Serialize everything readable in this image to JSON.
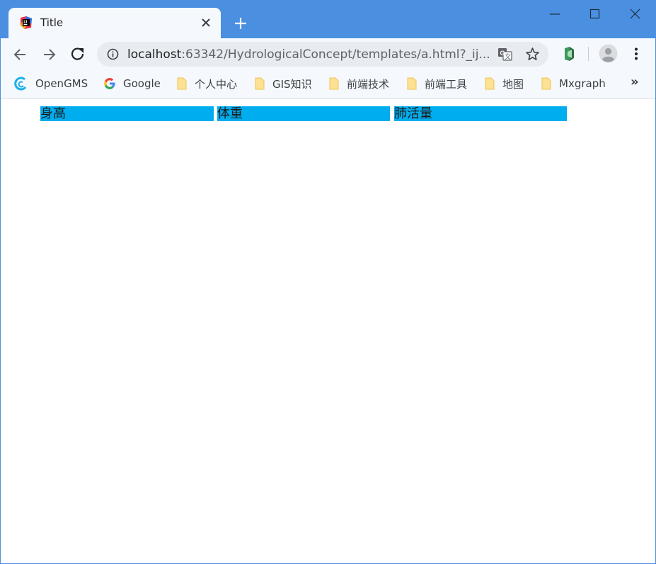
{
  "browser": {
    "tab": {
      "title": "Title",
      "favicon": "intellij-logo-icon"
    },
    "address_bar": {
      "host": "localhost",
      "rest": ":63342/HydrologicalConcept/templates/a.html?_ij..."
    },
    "bookmarks": [
      {
        "label": "OpenGMS",
        "icon": "opengms-logo-icon"
      },
      {
        "label": "Google",
        "icon": "google-logo-icon"
      },
      {
        "label": "个人中心",
        "icon": "folder-icon"
      },
      {
        "label": "GIS知识",
        "icon": "folder-icon"
      },
      {
        "label": "前端技术",
        "icon": "folder-icon"
      },
      {
        "label": "前端工具",
        "icon": "folder-icon"
      },
      {
        "label": "地图",
        "icon": "folder-icon"
      },
      {
        "label": "Mxgraph",
        "icon": "folder-icon"
      }
    ],
    "bookmarks_overflow": "»",
    "colors": {
      "frame": "#4a8fe0",
      "toolbar": "#f5f8fd",
      "omnibox": "#e8ebf0"
    }
  },
  "page": {
    "headers": [
      "身高",
      "体重",
      "肺活量"
    ],
    "header_bg": "#00adee"
  }
}
